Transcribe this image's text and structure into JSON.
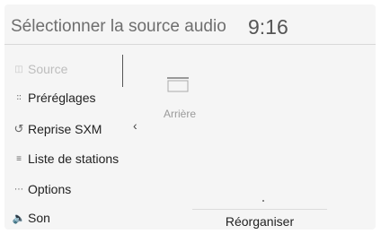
{
  "header": {
    "title": "Sélectionner la source audio",
    "time": "9:16"
  },
  "menu": {
    "items": [
      {
        "label": "Source",
        "icon": "source-icon",
        "selected": true
      },
      {
        "label": "Préréglages",
        "icon": "presets-icon",
        "selected": false
      },
      {
        "label": "Reprise SXM",
        "icon": "replay-icon",
        "selected": false
      },
      {
        "label": "Liste de stations",
        "icon": "station-list-icon",
        "selected": false
      },
      {
        "label": "Options",
        "icon": "options-icon",
        "selected": false
      },
      {
        "label": "Son",
        "icon": "speaker-icon",
        "selected": false
      }
    ]
  },
  "content": {
    "collapse_icon": "chevron-left-icon",
    "rear_label": "Arrière"
  },
  "footer": {
    "reorder_label": "Réorganiser"
  }
}
